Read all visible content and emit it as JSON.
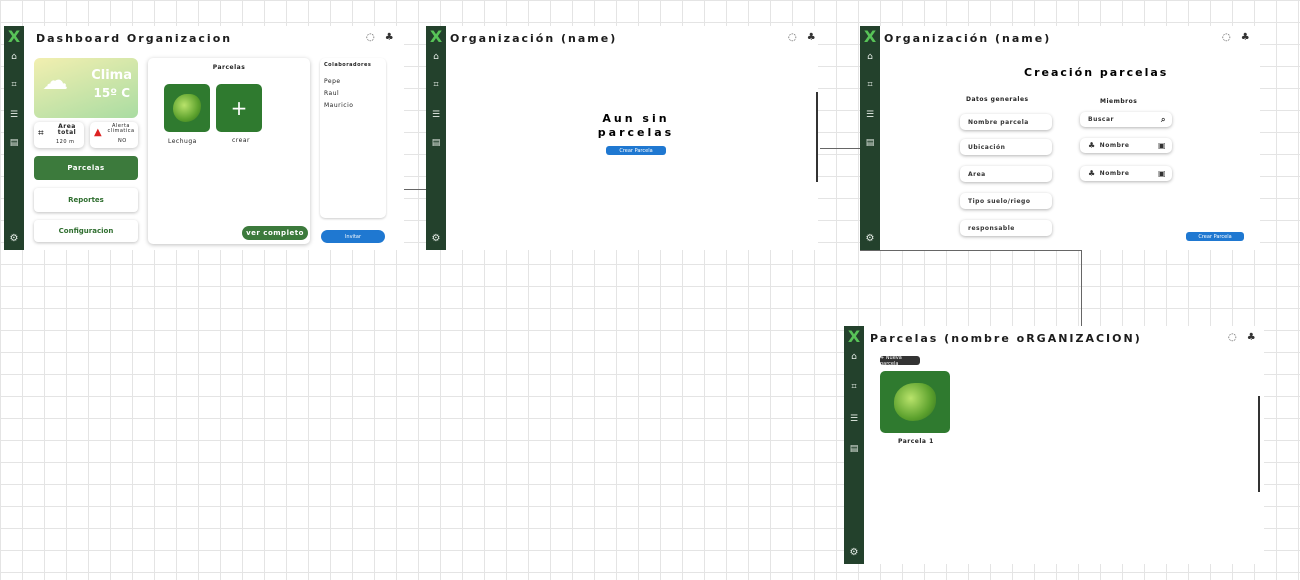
{
  "sidebar": {
    "logo": "X",
    "icons": [
      "home-icon",
      "parcel-frame-icon",
      "checklist-icon",
      "document-icon"
    ],
    "settings_icon": "gear-icon",
    "glyphs": {
      "home": "⌂",
      "frame": "⌗",
      "list": "☰",
      "doc": "▤",
      "gear": "⚙"
    }
  },
  "header_icons": {
    "bell": "◌",
    "user": "♣"
  },
  "screen1": {
    "title": "Dashboard Organizacion",
    "weather": {
      "label": "Clima",
      "temp": "15º C",
      "icon": "☁"
    },
    "area": {
      "label": "Area total",
      "value": "120 m"
    },
    "alert": {
      "label": "Alerta climatica",
      "value": "NO"
    },
    "nav": {
      "parcelas": "Parcelas",
      "reportes": "Reportes",
      "configuracion": "Configuracion"
    },
    "parcelas_card": {
      "title": "Parcelas",
      "tiles": [
        {
          "label": "Lechuga"
        },
        {
          "label": "crear",
          "symbol": "+"
        }
      ],
      "button": "ver completo"
    },
    "colaboradores": {
      "title": "Colaboradores",
      "names": [
        "Pepe",
        "Raul",
        "Mauricio"
      ],
      "button": "Invitar"
    }
  },
  "screen2": {
    "title": "Organización (name)",
    "empty_line1": "Aun sin",
    "empty_line2": "parcelas",
    "button": "Crear Parcela"
  },
  "screen3": {
    "title": "Organización (name)",
    "heading": "Creación parcelas",
    "general_label": "Datos generales",
    "fields": [
      "Nombre parcela",
      "Ubicación",
      "Area",
      "Tipo suelo/riego",
      "responsable"
    ],
    "members_label": "Miembros",
    "search_placeholder": "Buscar",
    "members": [
      "Nombre",
      "Nombre"
    ],
    "button": "Crear Parcela"
  },
  "screen4": {
    "title": "Parcelas (nombre oRGANIZACION)",
    "new_button": "+ Nueva parcela",
    "parcel_label": "Parcela 1"
  }
}
